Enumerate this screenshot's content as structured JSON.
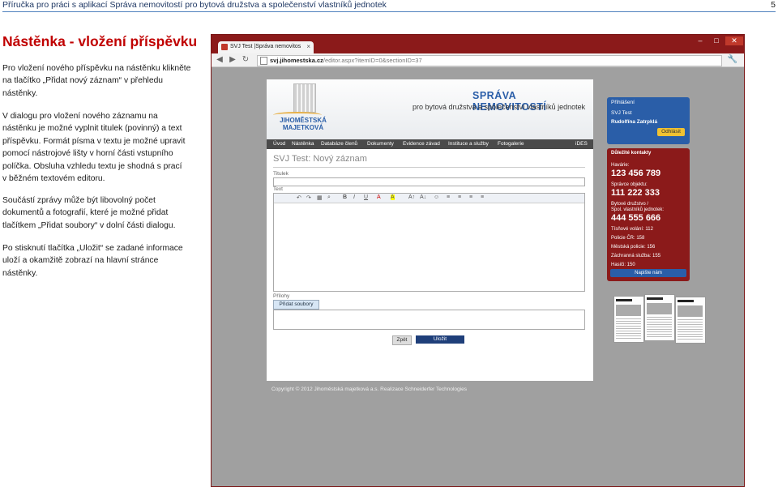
{
  "header": {
    "title": "Příručka pro práci s aplikací Správa nemovitostí pro bytová družstva a společenství vlastníků jednotek",
    "page_number": "5"
  },
  "section_title": "Nástěnka - vložení příspěvku",
  "paragraphs": [
    [
      "Pro vložení nového příspěvku na nástěnku klikněte",
      "na tlačítko „Přidat nový záznam“ v přehledu",
      "nástěnky."
    ],
    [
      "V dialogu pro vložení nového záznamu na",
      "nástěnku je možné vyplnit titulek (povinný) a text",
      "příspěvku. Formát písma v textu je možné upravit",
      "pomocí nástrojové lišty v horní části vstupního",
      "políčka. Obsluha vzhledu textu je shodná s prací",
      "v běžném textovém editoru."
    ],
    [
      "Součástí zprávy může být libovolný počet",
      "dokumentů a fotografií, které je možné přidat",
      "tlačítkem „Přidat soubory“ v dolní části dialogu."
    ],
    [
      "Po stisknutí tlačítka „Uložit“ se zadané informace",
      "uloží a okamžitě zobrazí na hlavní stránce",
      "nástěnky."
    ]
  ],
  "browser": {
    "tab_title": "SVJ Test |Správa nemovitos",
    "tab_close": "×",
    "window_controls": [
      "–",
      "□",
      "✕"
    ],
    "nav": [
      "◀",
      "▶",
      "↻"
    ],
    "url_host": "svj.jihomestska.cz",
    "url_path": "/editor.aspx?itemID=0&sectionID=37",
    "wrench": "🔧"
  },
  "site": {
    "logo_text": [
      "JIHOMĚSTSKÁ",
      "MAJETKOVÁ"
    ],
    "brand": "SPRÁVA NEMOVITOSTÍ",
    "tagline": "pro bytová družstva a společenství vlastníků jednotek",
    "nav": [
      "Úvod",
      "Nástěnka",
      "Databáze členů",
      "Dokumenty",
      "Evidence závad",
      "Instituce a služby",
      "Fotogalerie",
      "iDES"
    ],
    "form_title": "SVJ Test: Nový záznam",
    "title_label": "Titulek",
    "text_label": "Text",
    "editor_toolbar": [
      "↶",
      "↷",
      "▦",
      "⌕",
      "B",
      "I",
      "U",
      "A",
      "A",
      "A↑",
      "A↓",
      "☺",
      "≡",
      "≡",
      "≡",
      "≡"
    ],
    "attachments_label": "Přílohy",
    "add_files": "Přidat soubory",
    "cancel": "Zpět",
    "save": "Uložit",
    "login": {
      "header": "Přihlášení",
      "user1": "SVJ Test",
      "user2": "Rudolfína Zatrpklá",
      "logout": "Odhlásit"
    },
    "contacts": {
      "title": "Důležité kontakty",
      "havarie_label": "Havárie:",
      "havarie": "123 456 789",
      "spravce_label": "Správce objektu:",
      "spravce": "111 222 333",
      "druzstvo_label1": "Bytové družstvo /",
      "druzstvo_label2": "Spol. vlastníků jednotek:",
      "druzstvo": "444 555 666",
      "tisnove": "Tísňové volání: 112",
      "policie": "Policie ČR: 158",
      "mestska": "Městská policie: 156",
      "zachranna": "Záchranná služba: 155",
      "hasici": "Hasiči: 150",
      "write": "Napište nám"
    },
    "footer": "Copyright © 2012 Jihoměstská majetková a.s.     Realizace Schneiderfer Technologies"
  }
}
